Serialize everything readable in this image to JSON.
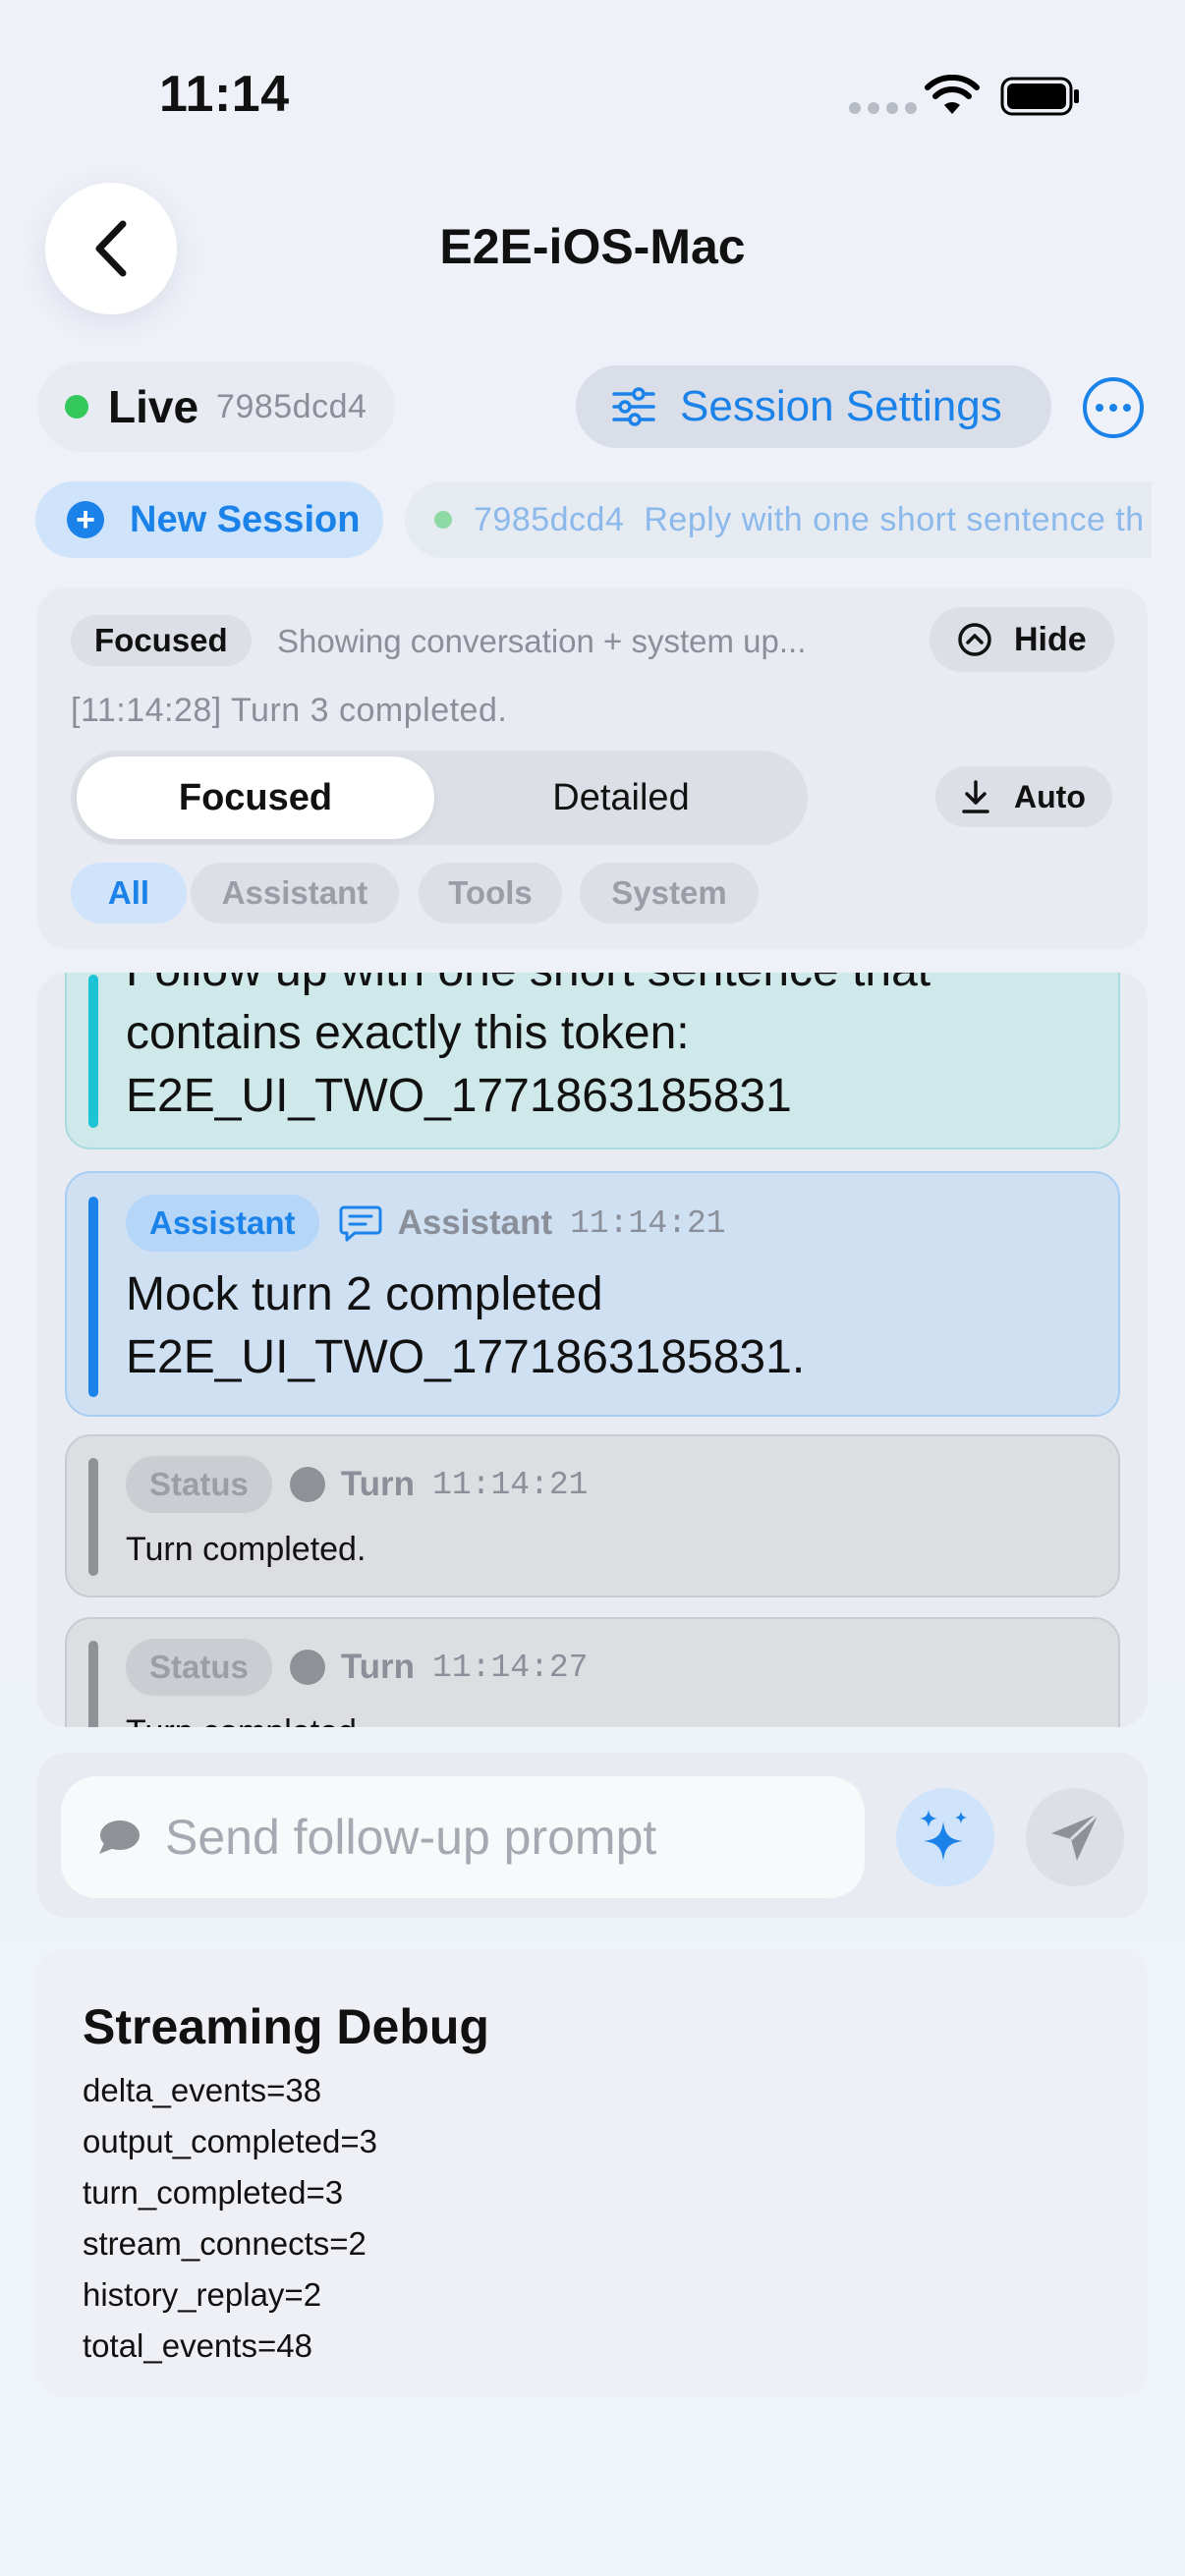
{
  "status_bar": {
    "time": "11:14"
  },
  "nav": {
    "title": "E2E-iOS-Mac"
  },
  "session_bar": {
    "live_label": "Live",
    "live_id": "7985dcd4",
    "settings_label": "Session Settings"
  },
  "session_row": {
    "new_session_label": "New Session",
    "chip_id": "7985dcd4",
    "chip_preview": "Reply with one short sentence th"
  },
  "filter": {
    "mode_badge": "Focused",
    "description": "Showing conversation + system up...",
    "hide_label": "Hide",
    "log_line": "[11:14:28] Turn 3 completed.",
    "segments": [
      "Focused",
      "Detailed"
    ],
    "auto_label": "Auto",
    "chips": [
      "All",
      "Assistant",
      "Tools",
      "System"
    ]
  },
  "messages": [
    {
      "role": "user",
      "text": "Follow up with one short sentence that contains exactly this token: E2E_UI_TWO_1771863185831"
    },
    {
      "role_badge": "Assistant",
      "author": "Assistant",
      "time": "11:14:21",
      "text": "Mock turn 2 completed E2E_UI_TWO_1771863185831."
    },
    {
      "role_badge": "Status",
      "author": "Turn",
      "time": "11:14:21",
      "text": "Turn completed."
    },
    {
      "role_badge": "Status",
      "author": "Turn",
      "time": "11:14:27",
      "text": "Turn completed."
    }
  ],
  "composer": {
    "placeholder": "Send follow-up prompt"
  },
  "debug": {
    "title": "Streaming Debug",
    "lines": [
      "delta_events=38",
      "output_completed=3",
      "turn_completed=3",
      "stream_connects=2",
      "history_replay=2",
      "total_events=48"
    ]
  },
  "colors": {
    "accent": "#1a82e8",
    "live": "#34c759",
    "user_bar": "#1cc4d6",
    "status_bar": "#8e9196"
  },
  "icons": [
    "chevron-left-icon",
    "wifi-icon",
    "battery-icon",
    "sliders-icon",
    "ellipsis-circle-icon",
    "plus-circle-icon",
    "chevron-up-circle-icon",
    "download-icon",
    "chat-bubble-icon",
    "sparkles-icon",
    "send-icon"
  ]
}
